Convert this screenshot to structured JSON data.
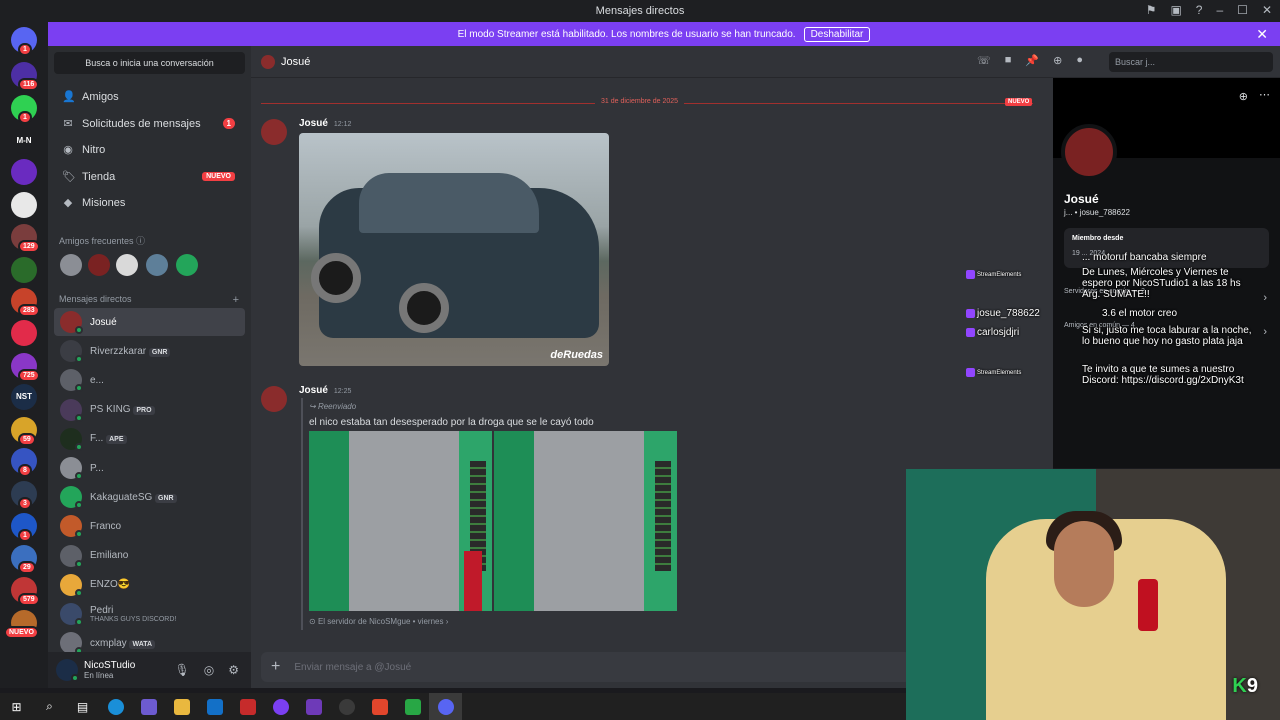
{
  "window": {
    "title": "Mensajes directos"
  },
  "banner": {
    "text": "El modo Streamer está habilitado. Los nombres de usuario se han truncado.",
    "button": "Deshabilitar"
  },
  "guilds": [
    {
      "label": "",
      "badge": "1",
      "color": "#5865f2"
    },
    {
      "label": "",
      "badge": "116",
      "color": "#4d2fa5"
    },
    {
      "label": "",
      "badge": "1",
      "color": "#2fd152"
    },
    {
      "label": "M-N",
      "badge": "",
      "color": "#1e1f22"
    },
    {
      "label": "",
      "badge": "",
      "color": "#6a2bc0"
    },
    {
      "label": "",
      "badge": "",
      "color": "#e8e8e8"
    },
    {
      "label": "",
      "badge": "129",
      "color": "#7a3d3d"
    },
    {
      "label": "",
      "badge": "",
      "color": "#2a6b2a"
    },
    {
      "label": "",
      "badge": "283",
      "color": "#c7432a"
    },
    {
      "label": "",
      "badge": "",
      "color": "#e22b4a"
    },
    {
      "label": "",
      "badge": "725",
      "color": "#8a37c7"
    },
    {
      "label": "NST",
      "badge": "",
      "color": "#1b2d47"
    },
    {
      "label": "",
      "badge": "59",
      "color": "#d8a429"
    },
    {
      "label": "",
      "badge": "8",
      "color": "#3654c2"
    },
    {
      "label": "",
      "badge": "3",
      "color": "#2d3c52"
    },
    {
      "label": "",
      "badge": "1",
      "color": "#1e57c8"
    },
    {
      "label": "",
      "badge": "29",
      "color": "#3b6fbf"
    },
    {
      "label": "",
      "badge": "579",
      "color": "#c03636"
    },
    {
      "label": "",
      "badge": "NUEVO",
      "color": "#b66a2a"
    }
  ],
  "sidebar": {
    "search_placeholder": "Busca o inicia una conversación",
    "nav": [
      {
        "label": "Amigos",
        "icon": "friends-icon",
        "badge": ""
      },
      {
        "label": "Solicitudes de mensajes",
        "icon": "mail-icon",
        "badge": "1"
      },
      {
        "label": "Nitro",
        "icon": "nitro-icon",
        "badge": ""
      },
      {
        "label": "Tienda",
        "icon": "shop-icon",
        "badge": "NUEVO"
      },
      {
        "label": "Misiones",
        "icon": "quest-icon",
        "badge": ""
      }
    ],
    "frequent_title": "Amigos frecuentes",
    "dm_title": "Mensajes directos",
    "dms": [
      {
        "name": "Josué",
        "tag": "",
        "subtitle": "",
        "active": true
      },
      {
        "name": "Riverzzkarar",
        "tag": "GNR",
        "subtitle": "",
        "active": false
      },
      {
        "name": "e...",
        "tag": "",
        "subtitle": "",
        "active": false
      },
      {
        "name": "PS KING",
        "tag": "PRO",
        "subtitle": "",
        "active": false
      },
      {
        "name": "F...",
        "tag": "APE",
        "subtitle": "",
        "active": false
      },
      {
        "name": "P...",
        "tag": "",
        "subtitle": "",
        "active": false
      },
      {
        "name": "KakaguateSG",
        "tag": "GNR",
        "subtitle": "",
        "active": false
      },
      {
        "name": "Franco",
        "tag": "",
        "subtitle": "",
        "active": false
      },
      {
        "name": "Emiliano",
        "tag": "",
        "subtitle": "",
        "active": false
      },
      {
        "name": "ENZO😎",
        "tag": "",
        "subtitle": "",
        "active": false
      },
      {
        "name": "Pedri",
        "tag": "",
        "subtitle": "THANKS GUYS DISCORD!",
        "active": false
      },
      {
        "name": "cxmplay",
        "tag": "WATA",
        "subtitle": "",
        "active": false
      }
    ]
  },
  "user_panel": {
    "name": "NicoSTudio",
    "status": "En línea"
  },
  "chat": {
    "header_name": "Josué",
    "search_placeholder": "Buscar j...",
    "date_divider": "31 de diciembre de 2025",
    "new_label": "NUEVO",
    "messages": [
      {
        "author": "Josué",
        "time": "12:12"
      },
      {
        "author": "Josué",
        "time": "12:25",
        "forwarded": "Reenviado",
        "text": "el nico estaba tan desesperado por la droga que se le cayó todo",
        "source": "El servidor de NicoSMgue",
        "source_time": "viernes"
      }
    ],
    "image_watermark": "deRuedas",
    "composer_placeholder": "Enviar mensaje a @Josué"
  },
  "profile": {
    "name": "Josué",
    "username": "j... • josue_788622",
    "member_since": "Miembro desde",
    "member_date": "19 ... 2024",
    "servers_common": "Servidores en común — 2",
    "friends_common": "Amigos en común — 4"
  },
  "stream_chat": [
    {
      "user": "StreamElements",
      "text": "... motoruf bancaba siempre"
    },
    {
      "user": "StreamElements",
      "text": "De Lunes, Miércoles y Viernes te espero por NicoSTudio1 a las 18 hs Arg. SUMATE!!"
    },
    {
      "user": "josue_788622",
      "text": "3.6 el motor creo"
    },
    {
      "user": "carlosjdjri",
      "text": "Si si, justo me toca laburar a la noche, lo bueno que hoy no gasto plata jaja"
    },
    {
      "user": "StreamElements",
      "text": "Te invito a que te sumes a nuestro Discord: https://discord.gg/2xDnyK3t"
    }
  ],
  "webcam": {
    "logo_letter": "K",
    "logo_number": "9"
  }
}
